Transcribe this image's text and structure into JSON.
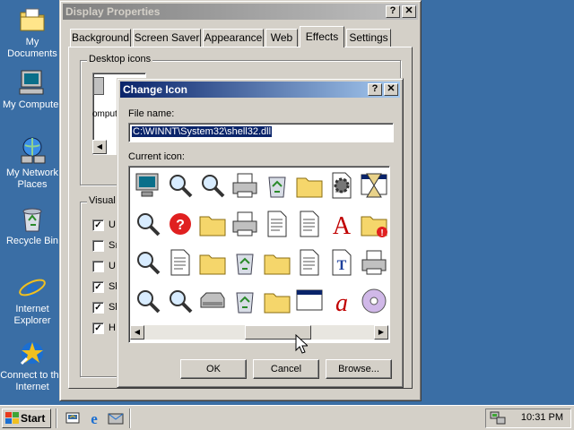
{
  "desktop": {
    "icons": [
      {
        "label": "My Documents",
        "icon": "folder-icon"
      },
      {
        "label": "My Computer",
        "icon": "computer-icon"
      },
      {
        "label": "My Network Places",
        "icon": "network-icon"
      },
      {
        "label": "Recycle Bin",
        "icon": "recycle-bin-icon"
      },
      {
        "label": "Internet Explorer",
        "icon": "ie-icon"
      },
      {
        "label": "Connect to the Internet",
        "icon": "connect-icon"
      }
    ],
    "background": "#3a6ea5"
  },
  "display_properties": {
    "title": "Display Properties",
    "help_button": "?",
    "close_button": "✕",
    "tabs": [
      "Background",
      "Screen Saver",
      "Appearance",
      "Web",
      "Effects",
      "Settings"
    ],
    "active_tab": "Effects",
    "desktop_icons_group": "Desktop icons",
    "icon_preview_label": "omputer",
    "visual_group": "Visual",
    "visual_checkboxes": [
      {
        "label": "U",
        "checked": true
      },
      {
        "label": "Sı",
        "checked": false
      },
      {
        "label": "U",
        "checked": false
      },
      {
        "label": "Sl",
        "checked": true
      },
      {
        "label": "Sl",
        "checked": true
      },
      {
        "label": "H",
        "checked": true
      }
    ]
  },
  "change_icon": {
    "title": "Change Icon",
    "help_button": "?",
    "close_button": "✕",
    "file_name_label": "File name:",
    "file_name_value": "C:\\WINNT\\System32\\shell32.dll",
    "current_icon_label": "Current icon:",
    "ok_label": "OK",
    "cancel_label": "Cancel",
    "browse_label": "Browse...",
    "icons": [
      "network-computer-icon",
      "computer-search-icon",
      "monitor-search-icon",
      "printer-icon",
      "recycle-bin-full-icon",
      "folder-settings-icon",
      "settings-document-icon",
      "hourglass-window-icon",
      "find-computer-icon",
      "help-disk-icon",
      "folder-tools-icon",
      "printer-network-icon",
      "document-copy-icon",
      "text-document-icon",
      "font-a-icon",
      "folder-error-icon",
      "find-icon",
      "blank-document-icon",
      "drive-folder-icon",
      "recycle-bin-icon",
      "folder-arrow-icon",
      "notepad-icon",
      "truetype-font-icon",
      "window-printer-icon",
      "find-computer-2-icon",
      "find-document-icon",
      "drive-icon",
      "recycle-bin-empty-icon",
      "folder-open-icon",
      "window-settings-icon",
      "font-italic-a-icon",
      "cd-drive-icon"
    ]
  },
  "taskbar": {
    "start_label": "Start",
    "clock": "10:31 PM",
    "quick_launch": [
      "show-desktop-icon",
      "ie-icon",
      "outlook-icon"
    ],
    "tray_icon": "network-tray-icon"
  }
}
